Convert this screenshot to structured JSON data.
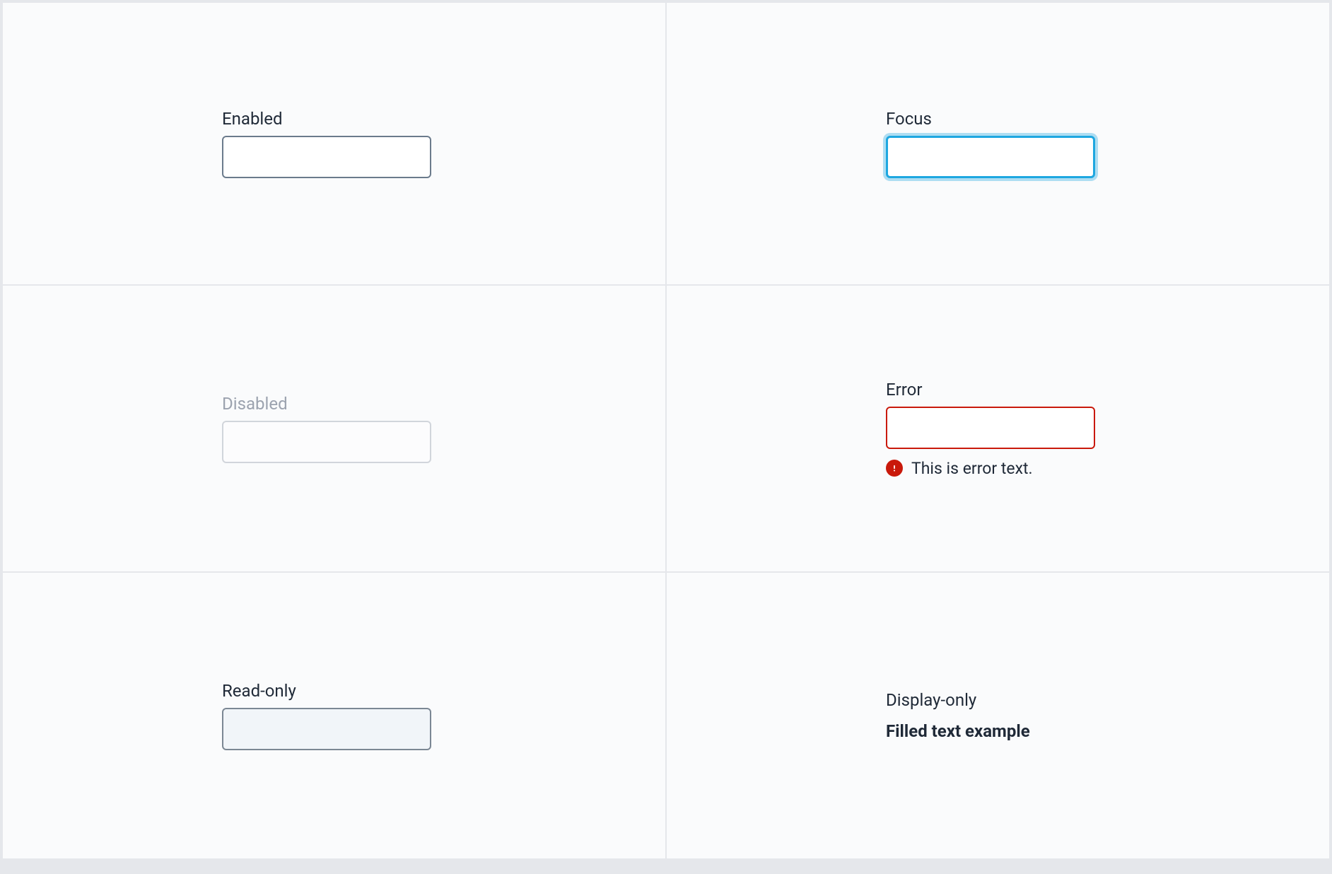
{
  "states": {
    "enabled": {
      "label": "Enabled",
      "value": ""
    },
    "focus": {
      "label": "Focus",
      "value": ""
    },
    "disabled": {
      "label": "Disabled",
      "value": ""
    },
    "error": {
      "label": "Error",
      "value": "",
      "error_text": "This is error text."
    },
    "readonly": {
      "label": "Read-only",
      "value": ""
    },
    "display": {
      "label": "Display-only",
      "value": "Filled text example"
    }
  },
  "colors": {
    "border_default": "#7b8794",
    "border_disabled": "#d1d5db",
    "focus_ring": "#1ea7e0",
    "error": "#c9190b",
    "cell_bg": "#fafbfc"
  }
}
